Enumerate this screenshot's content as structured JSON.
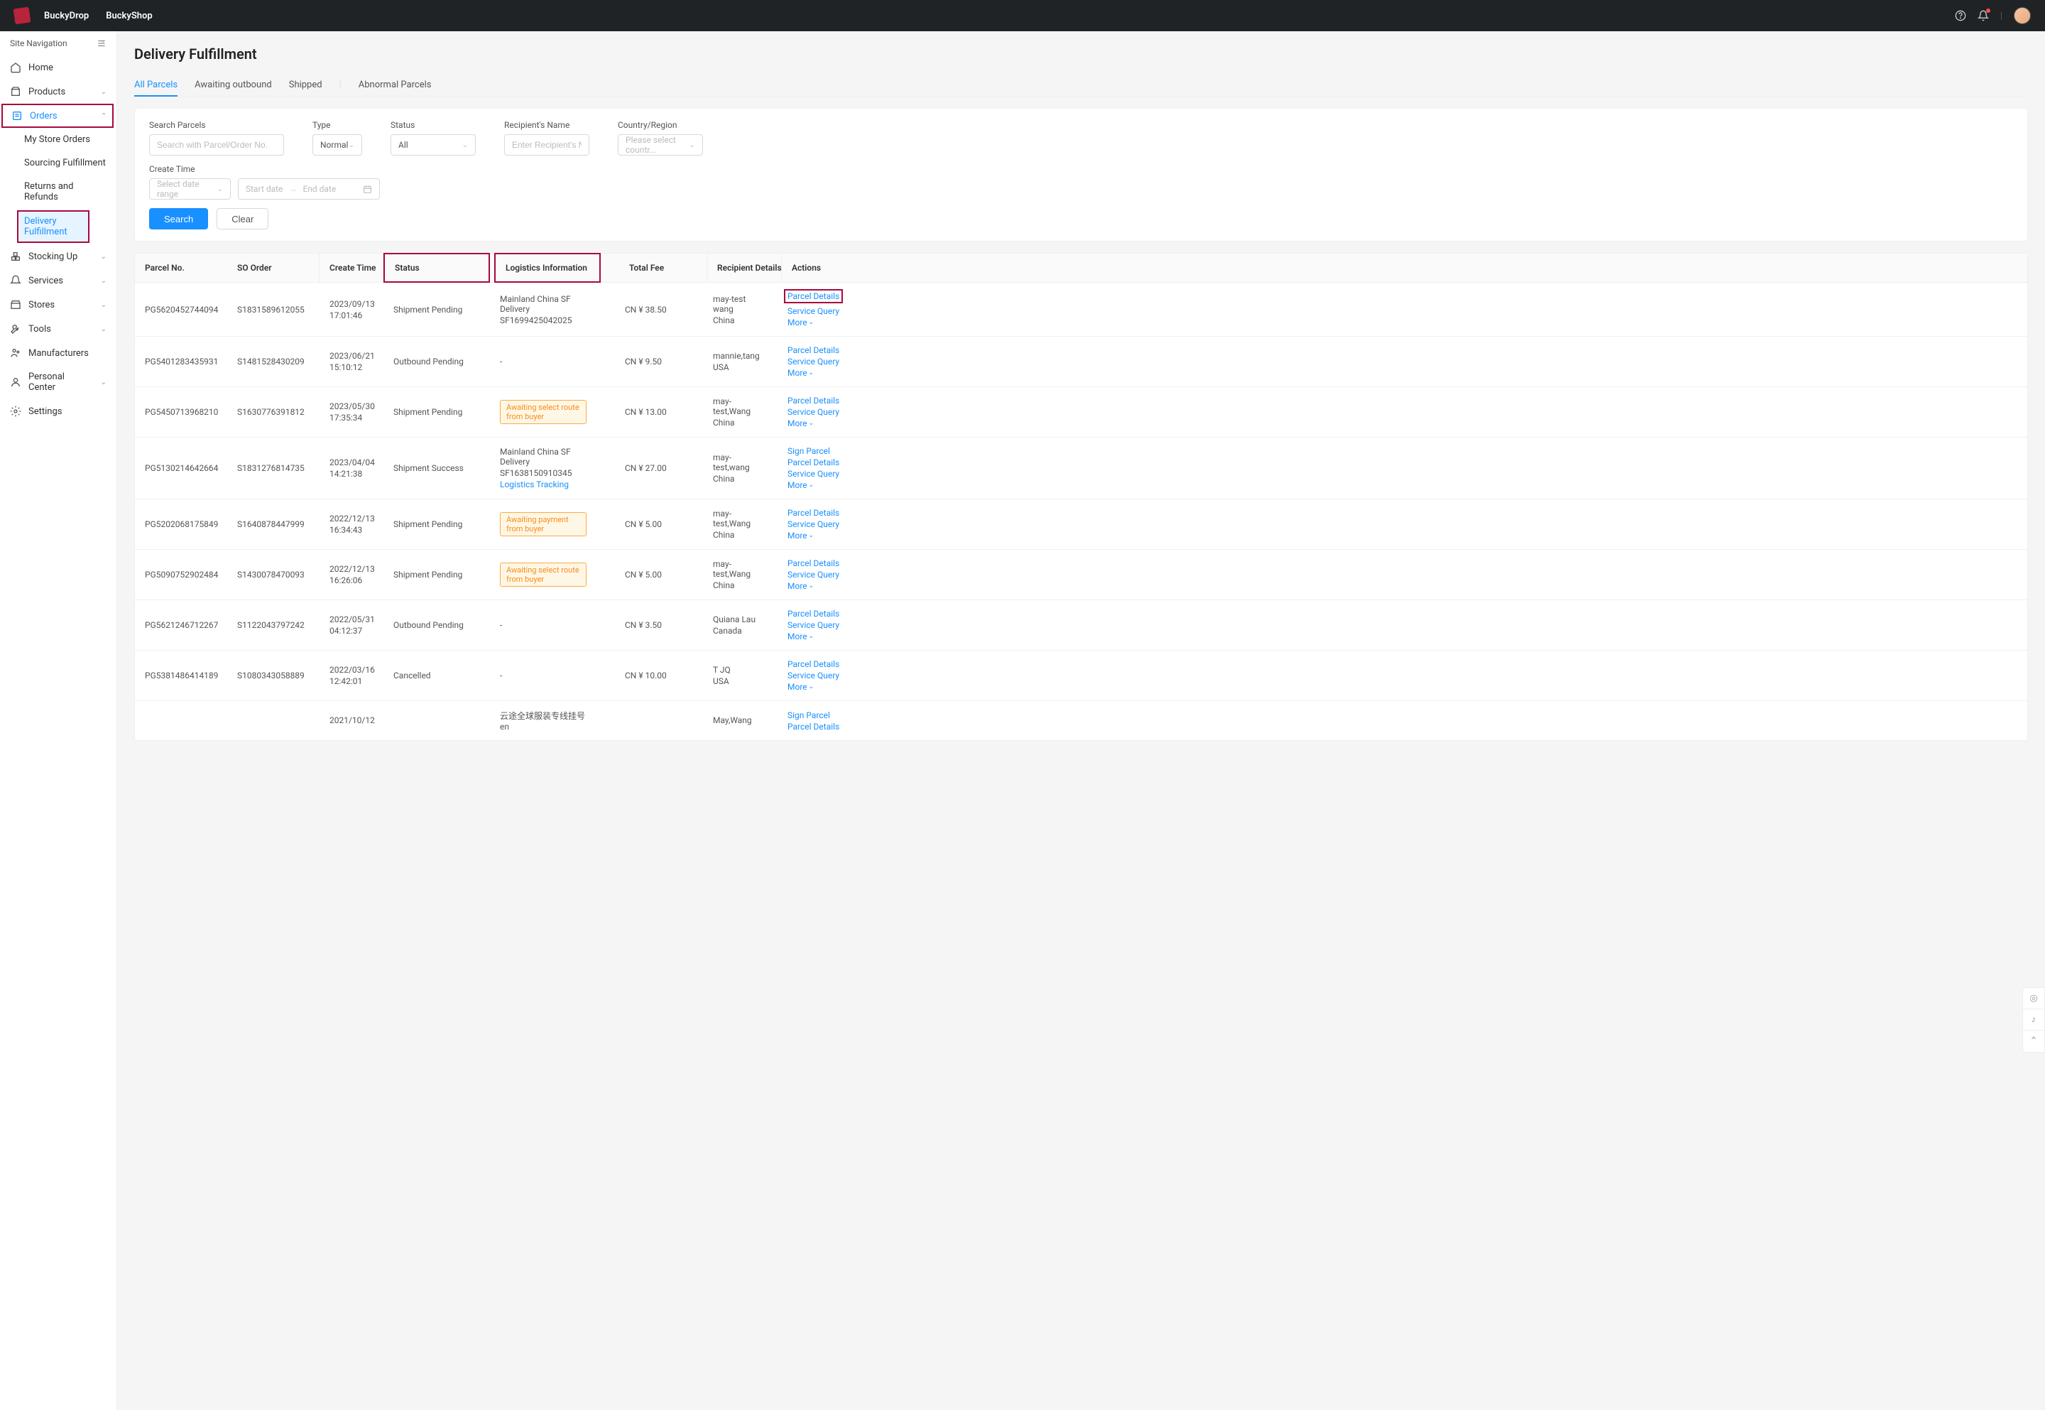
{
  "header": {
    "brand1": "BuckyDrop",
    "brand2": "BuckyShop"
  },
  "sidebar": {
    "title": "Site Navigation",
    "items": [
      {
        "label": "Home",
        "icon": "home"
      },
      {
        "label": "Products",
        "icon": "box",
        "expandable": true
      },
      {
        "label": "Orders",
        "icon": "list",
        "expandable": true,
        "highlighted": true,
        "expanded": true,
        "children": [
          {
            "label": "My Store Orders"
          },
          {
            "label": "Sourcing Fulfillment"
          },
          {
            "label": "Returns and Refunds"
          },
          {
            "label": "Delivery Fulfillment",
            "active": true,
            "highlighted": true
          }
        ]
      },
      {
        "label": "Stocking Up",
        "icon": "stack",
        "expandable": true
      },
      {
        "label": "Services",
        "icon": "bell",
        "expandable": true
      },
      {
        "label": "Stores",
        "icon": "store",
        "expandable": true
      },
      {
        "label": "Tools",
        "icon": "wrench",
        "expandable": true
      },
      {
        "label": "Manufacturers",
        "icon": "factory"
      },
      {
        "label": "Personal Center",
        "icon": "user",
        "expandable": true
      },
      {
        "label": "Settings",
        "icon": "gear"
      }
    ]
  },
  "page": {
    "title": "Delivery Fulfillment",
    "tabs": [
      "All Parcels",
      "Awaiting outbound",
      "Shipped",
      "Abnormal Parcels"
    ],
    "active_tab": 0
  },
  "filters": {
    "search_label": "Search Parcels",
    "search_placeholder": "Search with Parcel/Order No.",
    "type_label": "Type",
    "type_value": "Normal",
    "status_label": "Status",
    "status_value": "All",
    "recipient_label": "Recipient's Name",
    "recipient_placeholder": "Enter Recipient's Na...",
    "country_label": "Country/Region",
    "country_placeholder": "Please select countr...",
    "create_time_label": "Create Time",
    "date_range_placeholder": "Select date range",
    "start_date": "Start date",
    "end_date": "End date",
    "search_btn": "Search",
    "clear_btn": "Clear"
  },
  "table": {
    "headers": {
      "parcel": "Parcel No.",
      "so": "SO Order",
      "create": "Create Time",
      "status": "Status",
      "logistics": "Logistics Information",
      "fee": "Total Fee",
      "recipient": "Recipient Details",
      "actions": "Actions"
    },
    "action_labels": {
      "parcel_details": "Parcel Details",
      "service_query": "Service Query",
      "more": "More",
      "sign_parcel": "Sign Parcel",
      "logistics_tracking": "Logistics Tracking"
    },
    "rows": [
      {
        "parcel": "PG5620452744094",
        "so": "S1831589612055",
        "create": [
          "2023/09/13",
          "17:01:46"
        ],
        "status": "Shipment Pending",
        "logistics_lines": [
          "Mainland China SF Delivery",
          "SF1699425042025"
        ],
        "fee": "CN ¥ 38.50",
        "recipient": [
          "may-test wang",
          "China"
        ],
        "actions": [
          "Parcel Details",
          "Service Query",
          "More"
        ],
        "highlight_first_action": true
      },
      {
        "parcel": "PG5401283435931",
        "so": "S1481528430209",
        "create": [
          "2023/06/21",
          "15:10:12"
        ],
        "status": "Outbound Pending",
        "logistics_text": "-",
        "fee": "CN ¥ 9.50",
        "recipient": [
          "mannie,tang",
          "USA"
        ],
        "actions": [
          "Parcel Details",
          "Service Query",
          "More"
        ]
      },
      {
        "parcel": "PG5450713968210",
        "so": "S1630776391812",
        "create": [
          "2023/05/30",
          "17:35:34"
        ],
        "status": "Shipment Pending",
        "logistics_badge": "Awaiting select route from buyer",
        "fee": "CN ¥ 13.00",
        "recipient": [
          "may-test,Wang",
          "China"
        ],
        "actions": [
          "Parcel Details",
          "Service Query",
          "More"
        ]
      },
      {
        "parcel": "PG5130214642664",
        "so": "S1831276814735",
        "create": [
          "2023/04/04",
          "14:21:38"
        ],
        "status": "Shipment Success",
        "logistics_lines": [
          "Mainland China SF Delivery",
          "SF1638150910345"
        ],
        "logistics_link": "Logistics Tracking",
        "fee": "CN ¥ 27.00",
        "recipient": [
          "may-test,wang",
          "China"
        ],
        "actions": [
          "Sign Parcel",
          "Parcel Details",
          "Service Query",
          "More"
        ]
      },
      {
        "parcel": "PG5202068175849",
        "so": "S1640878447999",
        "create": [
          "2022/12/13",
          "16:34:43"
        ],
        "status": "Shipment Pending",
        "logistics_badge": "Awaiting payment from buyer",
        "fee": "CN ¥ 5.00",
        "recipient": [
          "may-test,Wang",
          "China"
        ],
        "actions": [
          "Parcel Details",
          "Service Query",
          "More"
        ]
      },
      {
        "parcel": "PG5090752902484",
        "so": "S1430078470093",
        "create": [
          "2022/12/13",
          "16:26:06"
        ],
        "status": "Shipment Pending",
        "logistics_badge": "Awaiting select route from buyer",
        "fee": "CN ¥ 5.00",
        "recipient": [
          "may-test,Wang",
          "China"
        ],
        "actions": [
          "Parcel Details",
          "Service Query",
          "More"
        ]
      },
      {
        "parcel": "PG5621246712267",
        "so": "S1122043797242",
        "create": [
          "2022/05/31",
          "04:12:37"
        ],
        "status": "Outbound Pending",
        "logistics_text": "-",
        "fee": "CN ¥ 3.50",
        "recipient": [
          "Quiana Lau",
          "Canada"
        ],
        "actions": [
          "Parcel Details",
          "Service Query",
          "More"
        ]
      },
      {
        "parcel": "PG5381486414189",
        "so": "S1080343058889",
        "create": [
          "2022/03/16",
          "12:42:01"
        ],
        "status": "Cancelled",
        "logistics_text": "-",
        "fee": "CN ¥ 10.00",
        "recipient": [
          "T JQ",
          "USA"
        ],
        "actions": [
          "Parcel Details",
          "Service Query",
          "More"
        ]
      },
      {
        "parcel": "",
        "so": "",
        "create": [
          "2021/10/12",
          ""
        ],
        "status": "",
        "logistics_lines": [
          "云途全球服装专线挂号en"
        ],
        "fee": "",
        "recipient": [
          "May,Wang",
          ""
        ],
        "actions": [
          "Sign Parcel",
          "Parcel Details"
        ]
      }
    ]
  }
}
